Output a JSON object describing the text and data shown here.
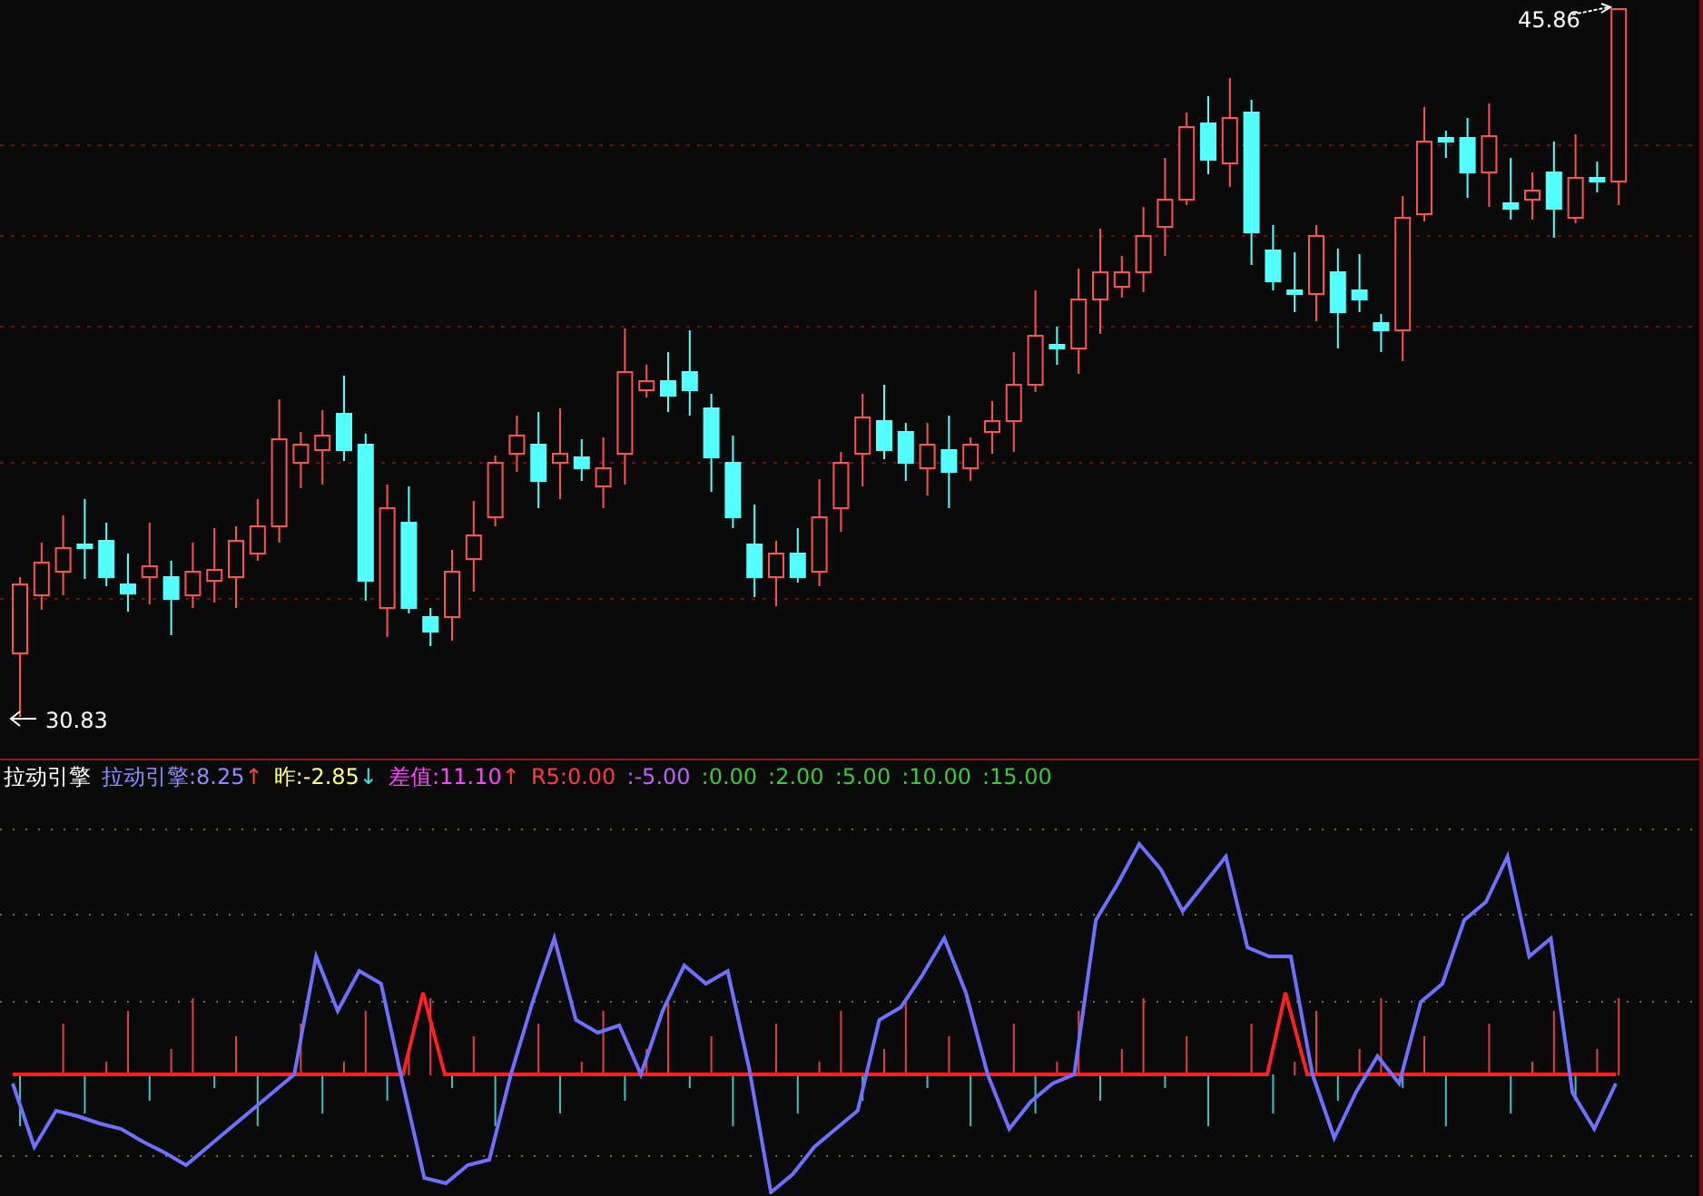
{
  "price_chart": {
    "high_label": "45.86",
    "low_label": "30.83"
  },
  "indicator": {
    "title": "拉动引擎",
    "legend": [
      {
        "kind": "value",
        "text": "拉动引擎:8.25",
        "color": "#8c8cff"
      },
      {
        "kind": "arrow",
        "text": "↑",
        "color": "#ff4040"
      },
      {
        "kind": "value",
        "text": "昨:-2.85",
        "color": "#ffff80"
      },
      {
        "kind": "arrow",
        "text": "↓",
        "color": "#40e0e0"
      },
      {
        "kind": "value",
        "text": "差值:11.10",
        "color": "#ff44ff"
      },
      {
        "kind": "arrow",
        "text": "↑",
        "color": "#ff4040"
      },
      {
        "kind": "value",
        "text": "R5:0.00",
        "color": "#ff3c3c"
      },
      {
        "kind": "value",
        "text": ":-5.00",
        "color": "#c060ff"
      },
      {
        "kind": "value",
        "text": ":0.00",
        "color": "#3cc83c"
      },
      {
        "kind": "value",
        "text": ":2.00",
        "color": "#3cc83c"
      },
      {
        "kind": "value",
        "text": ":5.00",
        "color": "#3cc83c"
      },
      {
        "kind": "value",
        "text": ":10.00",
        "color": "#3cc83c"
      },
      {
        "kind": "value",
        "text": ":15.00",
        "color": "#3cc83c"
      }
    ]
  }
}
